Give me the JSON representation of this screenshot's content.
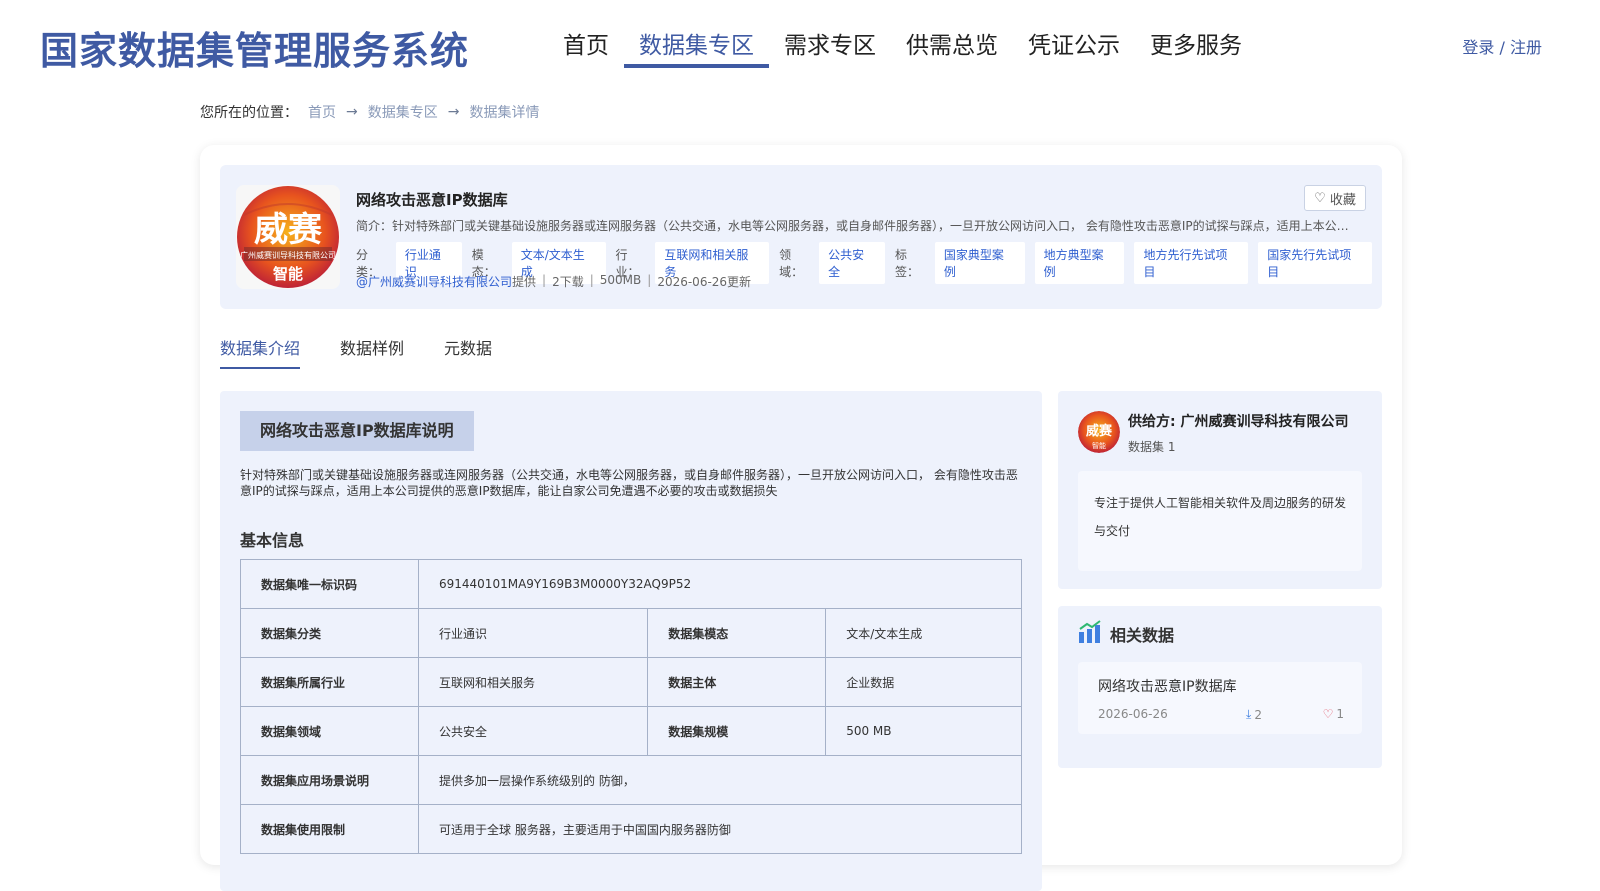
{
  "header": {
    "logo": "国家数据集管理服务系统",
    "nav": [
      "首页",
      "数据集专区",
      "需求专区",
      "供需总览",
      "凭证公示",
      "更多服务"
    ],
    "active_nav": 1,
    "auth": "登录 / 注册"
  },
  "breadcrumb": {
    "label": "您所在的位置：",
    "items": [
      "首页",
      "数据集专区",
      "数据集详情"
    ]
  },
  "dataset": {
    "logo_text_main": "威赛",
    "logo_text_sub": "广州威赛训导科技有限公司",
    "logo_text_bottom": "智能",
    "title": "网络攻击恶意IP数据库",
    "favorite": "收藏",
    "intro": "简介：针对特殊部门或关键基础设施服务器或连网服务器（公共交通，水电等公网服务器，或自身邮件服务器），一旦开放公网访问入口， 会有隐性攻击恶意IP的试探与踩点，适用上本公司提供的恶意IP数据库，能让自家公司免遭遇不必要的攻击或数据损失",
    "tags": [
      {
        "key": "分类：",
        "chips": [
          "行业通识"
        ]
      },
      {
        "key": "模态：",
        "chips": [
          "文本/文本生成"
        ]
      },
      {
        "key": "行业：",
        "chips": [
          "互联网和相关服务"
        ]
      },
      {
        "key": "领域：",
        "chips": [
          "公共安全"
        ]
      },
      {
        "key": "标签：",
        "chips": [
          "国家典型案例",
          "地方典型案例",
          "地方先行先试项目",
          "国家先行先试项目"
        ]
      }
    ],
    "provider": "@广州威赛训导科技有限公司",
    "provider_suffix": "提供",
    "downloads": "2下载",
    "size": "500MB",
    "updated": "2026-06-26更新"
  },
  "tabs": [
    "数据集介绍",
    "数据样例",
    "元数据"
  ],
  "active_tab": 0,
  "intro_section": {
    "title": "网络攻击恶意IP数据库说明",
    "description": "针对特殊部门或关键基础设施服务器或连网服务器（公共交通，水电等公网服务器，或自身邮件服务器），一旦开放公网访问入口， 会有隐性攻击恶意IP的试探与踩点，适用上本公司提供的恶意IP数据库，能让自家公司免遭遇不必要的攻击或数据损失",
    "basic_title": "基本信息"
  },
  "basic_info": {
    "id_key": "数据集唯一标识码",
    "id_val": "691440101MA9Y169B3M0000Y32AQ9P52",
    "category_key": "数据集分类",
    "category_val": "行业通识",
    "modal_key": "数据集模态",
    "modal_val": "文本/文本生成",
    "industry_key": "数据集所属行业",
    "industry_val": "互联网和相关服务",
    "subject_key": "数据主体",
    "subject_val": "企业数据",
    "domain_key": "数据集领域",
    "domain_val": "公共安全",
    "scale_key": "数据集规模",
    "scale_val": "500 MB",
    "scenario_key": "数据集应用场景说明",
    "scenario_val": "提供多加一层操作系统级别的 防御，",
    "limit_key": "数据集使用限制",
    "limit_val": "可适用于全球 服务器，主要适用于中国国内服务器防御"
  },
  "provider_card": {
    "logo_text": "威赛",
    "logo_text_bottom": "智能",
    "name": "供给方: 广州威赛训导科技有限公司",
    "count": "数据集 1",
    "description": "专注于提供人工智能相关软件及周边服务的研发与交付"
  },
  "related": {
    "title": "相关数据",
    "items": [
      {
        "name": "网络攻击恶意IP数据库",
        "date": "2026-06-26",
        "downloads": "2",
        "likes": "1"
      }
    ]
  },
  "colors": {
    "brand": "#3f5aa3",
    "link": "#2f5fd0",
    "panel": "#eef2fc"
  }
}
